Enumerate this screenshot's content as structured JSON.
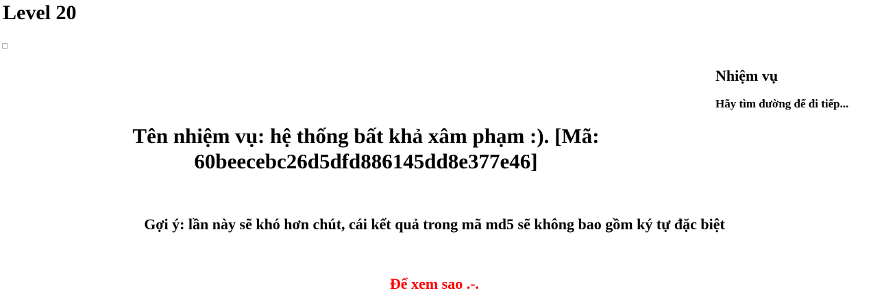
{
  "page": {
    "title": "Level 20"
  },
  "mission_panel": {
    "heading": "Nhiệm vụ",
    "description": "Hãy tìm đường để đi tiếp..."
  },
  "mission": {
    "name_line1": "Tên nhiệm vụ: hệ thống bất khả xâm phạm :). [Mã:",
    "name_line2": "60beecebc26d5dfd886145dd8e377e46]"
  },
  "hint": {
    "text": "Gợi ý: lần này sẽ khó hơn chút, cái kết quả trong mã md5 sẽ không bao gồm ký tự đặc biệt"
  },
  "teaser": {
    "text": "Để xem sao .-.",
    "color": "#ff0000"
  }
}
